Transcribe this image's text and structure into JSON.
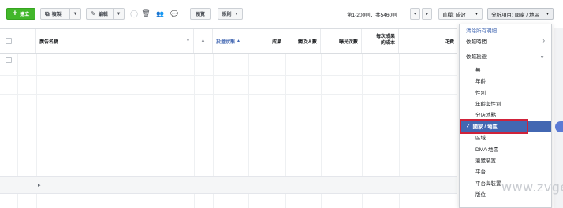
{
  "toolbar": {
    "create_label": "建立",
    "copy_label": "複製",
    "edit_label": "編輯",
    "preview_label": "預覽",
    "rules_label": "規則",
    "pager": "第1-200則，共5460則",
    "columns_label": "直欄: 成效",
    "breakdown_label": "分析項目: 國家 / 地區"
  },
  "table": {
    "headers": {
      "ad_name": "廣告名稱",
      "delivery": "投遞狀態",
      "results": "成果",
      "reach": "觸及人數",
      "impressions": "曝光次數",
      "cost_per_result_1": "每次成果",
      "cost_per_result_2": "的成本",
      "spend": "花費"
    }
  },
  "dropdown": {
    "clear_all": "清除所有明細",
    "by_time": "依照時間",
    "by_delivery": "依照投遞",
    "items": [
      "無",
      "年齡",
      "性別",
      "年齡與性別",
      "分店地點",
      "國家 / 地區",
      "區域",
      "DMA 地區",
      "瀏覽裝置",
      "平台",
      "平台與裝置",
      "版位"
    ],
    "selected": "國家 / 地區"
  },
  "watermark": "www.zvge.cn",
  "colors": {
    "primary": "#4267b2",
    "create_green": "#42b72a",
    "highlight_red": "#d0223a"
  }
}
